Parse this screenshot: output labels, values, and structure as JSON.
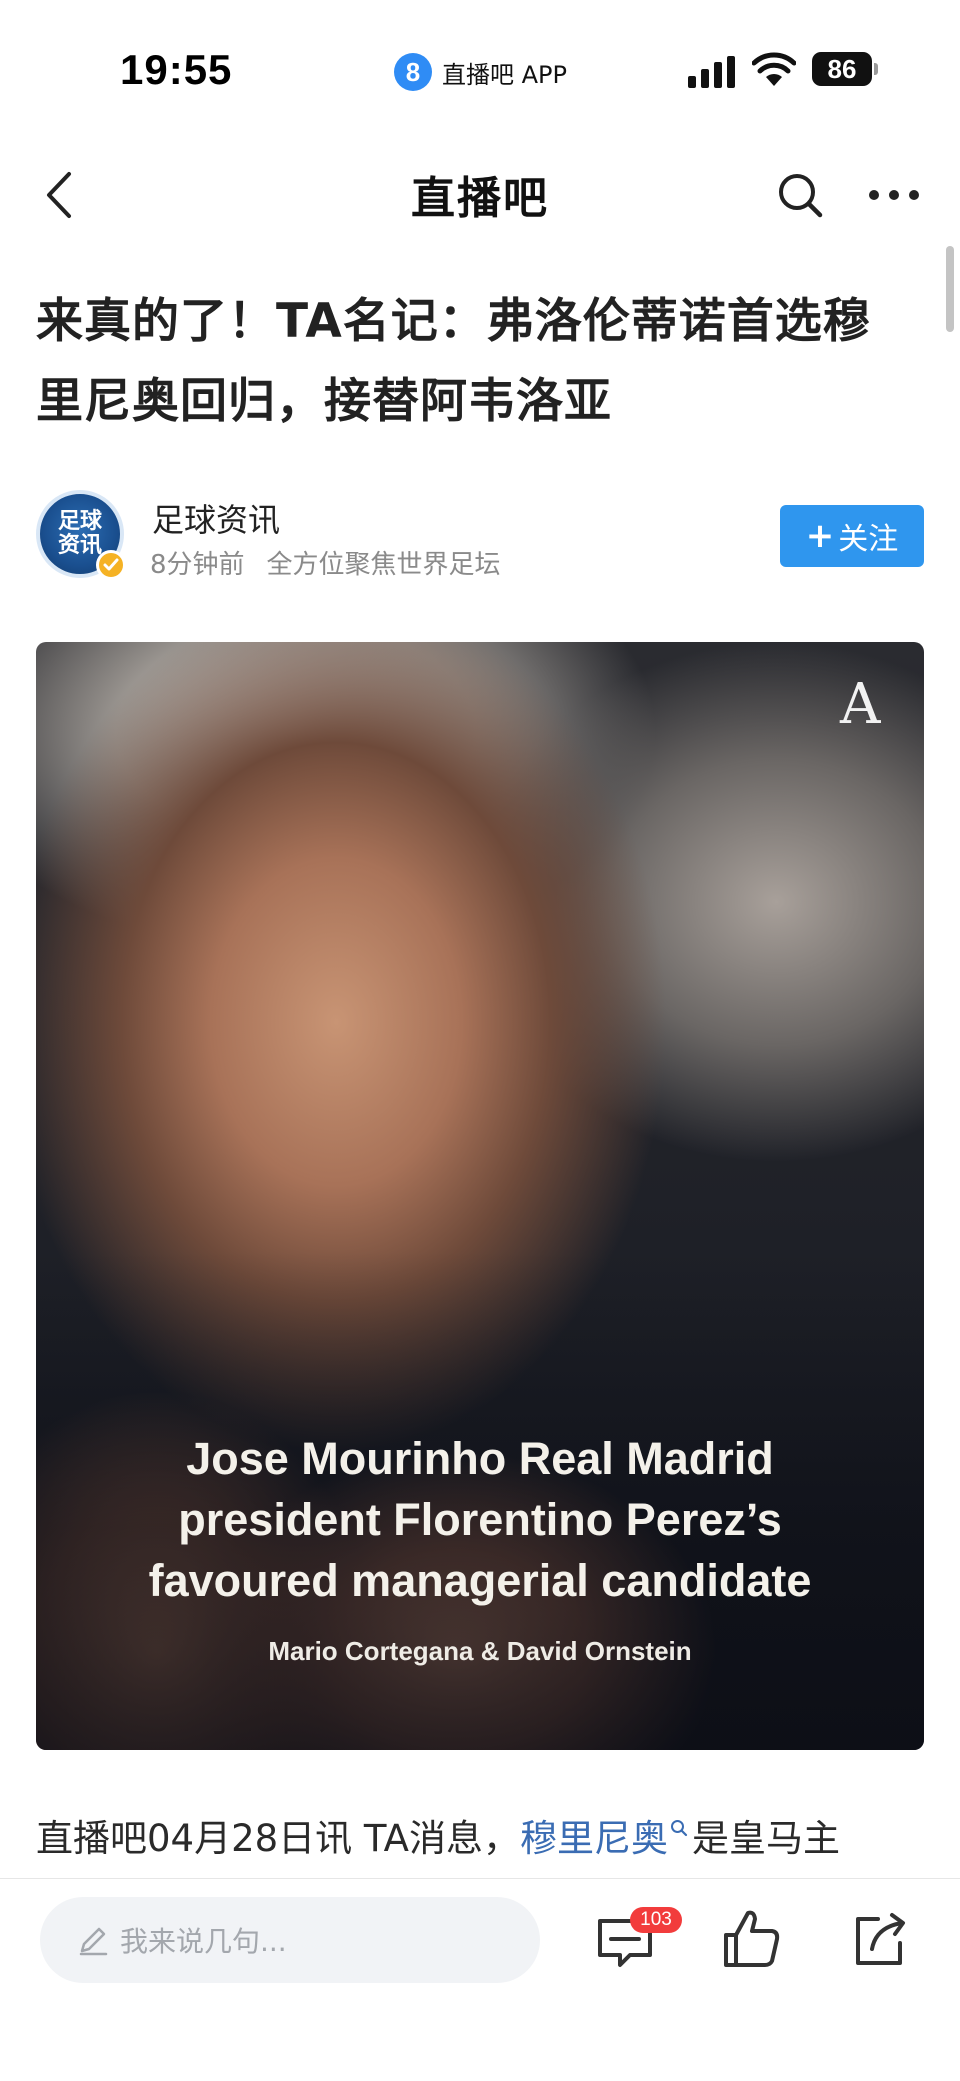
{
  "status_bar": {
    "time": "19:55",
    "app_badge": "8",
    "app_name": "直播吧 APP",
    "battery": "86",
    "icons": [
      "signal-icon",
      "wifi-icon",
      "battery-icon"
    ]
  },
  "nav": {
    "title": "直播吧",
    "icons": [
      "back-chevron-icon",
      "search-icon",
      "more-dots-icon"
    ]
  },
  "article": {
    "headline": "来真的了！TA名记：弗洛伦蒂诺首选穆里尼奥回归，接替阿韦洛亚",
    "author": {
      "avatar_line1": "足球",
      "avatar_line2": "资讯",
      "name": "足球资讯",
      "time": "8分钟前",
      "description": "全方位聚焦世界足坛",
      "follow_label": "关注",
      "follow_plus": "+"
    },
    "image": {
      "logo": "A",
      "headline_line1": "Jose Mourinho Real Madrid",
      "headline_line2": "president Florentino Perez’s",
      "headline_line3": "favoured managerial candidate",
      "byline": "Mario Cortegana & David Ornstein"
    },
    "body_prefix": "直播吧04月28日讯   TA消息，",
    "body_link": "穆里尼奥",
    "body_suffix": "是皇马主"
  },
  "bottom_bar": {
    "comment_placeholder": "我来说几句...",
    "comment_count": "103",
    "icons": [
      "pen-icon",
      "comment-icon",
      "like-icon",
      "share-icon"
    ]
  },
  "colors": {
    "accent_blue": "#2f96ee",
    "link_blue": "#3a6cb3",
    "badge_red": "#f23c3c",
    "verified_gold": "#f5b224"
  }
}
